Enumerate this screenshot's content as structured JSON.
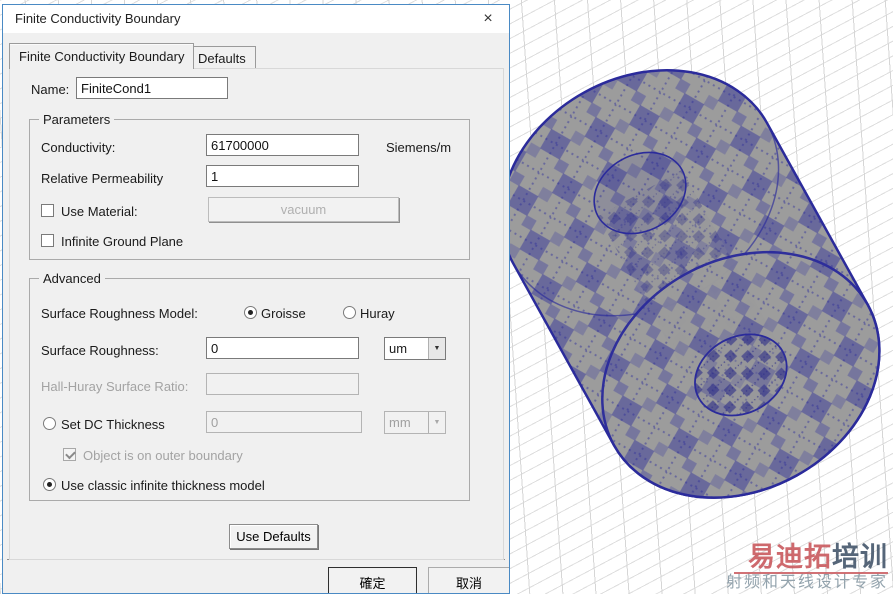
{
  "window": {
    "title": "Finite Conductivity Boundary",
    "close_glyph": "×"
  },
  "tabs": [
    {
      "label": "Finite Conductivity Boundary",
      "active": true
    },
    {
      "label": "Defaults",
      "active": false
    }
  ],
  "name_field": {
    "label": "Name:",
    "value": "FiniteCond1"
  },
  "parameters": {
    "group_label": "Parameters",
    "conductivity": {
      "label": "Conductivity:",
      "value": "61700000",
      "unit": "Siemens/m"
    },
    "relative_permeability": {
      "label": "Relative Permeability",
      "value": "1"
    },
    "use_material": {
      "label": "Use Material:",
      "checked": false,
      "material_button_label": "vacuum",
      "material_button_enabled": false
    },
    "infinite_ground_plane": {
      "label": "Infinite Ground Plane",
      "checked": false
    }
  },
  "advanced": {
    "group_label": "Advanced",
    "surface_roughness_model": {
      "label": "Surface Roughness Model:",
      "options": [
        "Groisse",
        "Huray"
      ],
      "selected": "Groisse"
    },
    "surface_roughness": {
      "label": "Surface Roughness:",
      "value": "0",
      "unit": "um"
    },
    "hall_huray_surface_ratio": {
      "label": "Hall-Huray Surface Ratio:",
      "value": "",
      "enabled": false
    },
    "set_dc_thickness": {
      "label": "Set DC Thickness",
      "selected": false,
      "value": "0",
      "unit": "mm",
      "enabled": false
    },
    "object_on_outer_boundary": {
      "label": "Object is on outer boundary",
      "checked": true,
      "enabled": false
    },
    "use_classic_model": {
      "label": "Use classic infinite thickness model",
      "selected": true
    }
  },
  "buttons": {
    "use_defaults": "Use Defaults",
    "ok": "確定",
    "cancel": "取消"
  },
  "dropdown_arrow_glyph": "▼",
  "viewport": {
    "description": "3D coax cylinder model with FEM mesh overlay on perspective grid",
    "body_color": "#9c9c9c",
    "mesh_color": "#3f3f9a",
    "outline_color": "#2b2b9b",
    "grid_color": "#d6d6d6"
  },
  "watermark": {
    "logo_red": "易迪拓",
    "logo_dark": "培训",
    "tagline": "射频和天线设计专家",
    "accent_color": "#c9595e"
  }
}
